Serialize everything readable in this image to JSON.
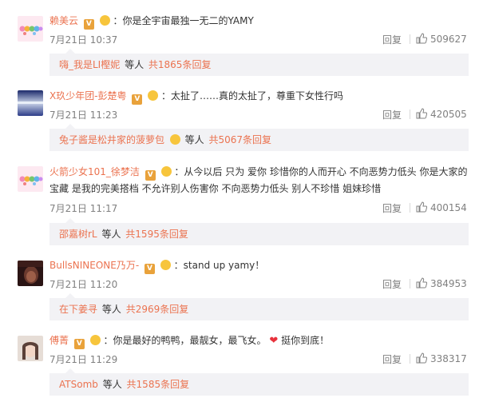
{
  "comments": [
    {
      "username": "赖美云",
      "text": "：你是全宇宙最独一无二的YAMY",
      "time": "7月21日 10:37",
      "reply": "回复",
      "likes": "509627",
      "sub": {
        "name": "嗨_我是LI樫妮",
        "text": "等人",
        "link": "共1865条回复"
      }
    },
    {
      "username": "X玖少年团-彭楚粤",
      "text": "：太扯了……真的太扯了，尊重下女性行吗",
      "time": "7月21日 11:23",
      "reply": "回复",
      "likes": "420505",
      "sub": {
        "name": "兔子酱是松井家的菠萝包",
        "text": "等人",
        "link": "共5067条回复"
      }
    },
    {
      "username": "火箭少女101_徐梦洁",
      "text": "：从今以后 只为 爱你 珍惜你的人而开心 不向恶势力低头 你是大家的",
      "text2": "宝藏 是我的完美搭档 不允许别人伤害你 不向恶势力低头 别人不珍惜 姐妹珍惜",
      "time": "7月21日 11:17",
      "reply": "回复",
      "likes": "400154",
      "sub": {
        "name": "邵嘉树rL",
        "text": "等人",
        "link": "共1595条回复"
      }
    },
    {
      "username": "BullsNINEONE乃万-",
      "text": "：stand up yamy！",
      "time": "7月21日 11:20",
      "reply": "回复",
      "likes": "384953",
      "sub": {
        "name": "在下姜寻",
        "text": "等人",
        "link": "共2969条回复"
      }
    },
    {
      "username": "傅菁",
      "text": "：你是最好的鸭鸭，最靓女，最飞女。",
      "text_after": "挺你到底！",
      "time": "7月21日 11:29",
      "reply": "回复",
      "likes": "338317",
      "sub": {
        "name": "ATSomb",
        "text": "等人",
        "link": "共1585条回复"
      }
    }
  ]
}
